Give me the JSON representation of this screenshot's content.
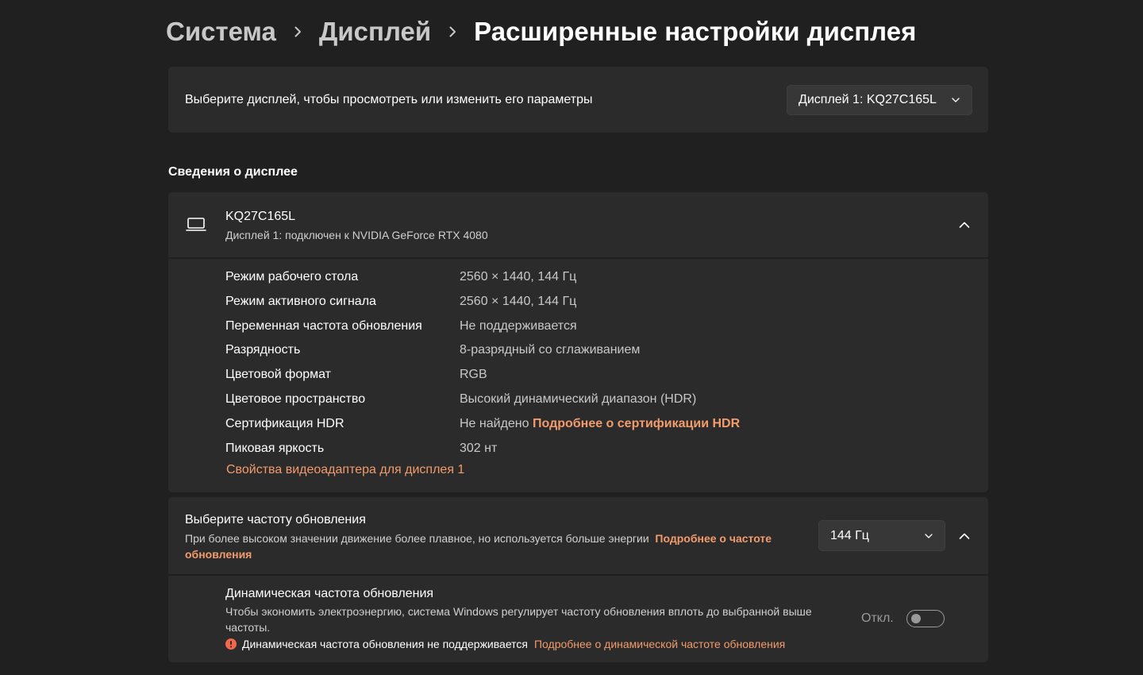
{
  "breadcrumb": {
    "items": [
      "Система",
      "Дисплей"
    ],
    "current": "Расширенные настройки дисплея"
  },
  "display_select": {
    "label": "Выберите дисплей, чтобы просмотреть или изменить его параметры",
    "selected": "Дисплей 1: KQ27C165L"
  },
  "section_title": "Сведения о дисплее",
  "display_info": {
    "name": "KQ27C165L",
    "subtitle": "Дисплей 1: подключен к NVIDIA GeForce RTX 4080",
    "rows": [
      {
        "key": "Режим рабочего стола",
        "value": "2560 × 1440, 144 Гц"
      },
      {
        "key": "Режим активного сигнала",
        "value": "2560 × 1440, 144 Гц"
      },
      {
        "key": "Переменная частота обновления",
        "value": "Не поддерживается"
      },
      {
        "key": "Разрядность",
        "value": "8-разрядный со сглаживанием"
      },
      {
        "key": "Цветовой формат",
        "value": "RGB"
      },
      {
        "key": "Цветовое пространство",
        "value": "Высокий динамический диапазон (HDR)"
      },
      {
        "key": "Сертификация HDR",
        "value": "Не найдено",
        "link": "Подробнее о сертификации HDR"
      },
      {
        "key": "Пиковая яркость",
        "value": "302 нт"
      }
    ],
    "adapter_link": "Свойства видеоадаптера для дисплея 1"
  },
  "refresh_rate": {
    "title": "Выберите частоту обновления",
    "description": "При более высоком значении движение более плавное, но используется больше энергии",
    "link": "Подробнее о частоте обновления",
    "selected": "144 Гц"
  },
  "dynamic_refresh": {
    "title": "Динамическая частота обновления",
    "description": "Чтобы экономить электроэнергию, система Windows регулирует частоту обновления вплоть до выбранной выше частоты.",
    "warning": "Динамическая частота обновления не поддерживается",
    "link": "Подробнее о динамической частоте обновления",
    "toggle_label": "Откл.",
    "toggle_on": false
  },
  "colors": {
    "background": "#202020",
    "card": "#2b2b2b",
    "accent_link": "#f29b6c",
    "warning_icon": "#f0694f"
  },
  "icons": {
    "breadcrumb_separator": "chevron-right-icon",
    "monitor": "laptop-icon",
    "expand": "chevron-up-icon",
    "dropdown": "chevron-down-icon",
    "warning": "warning-icon"
  }
}
